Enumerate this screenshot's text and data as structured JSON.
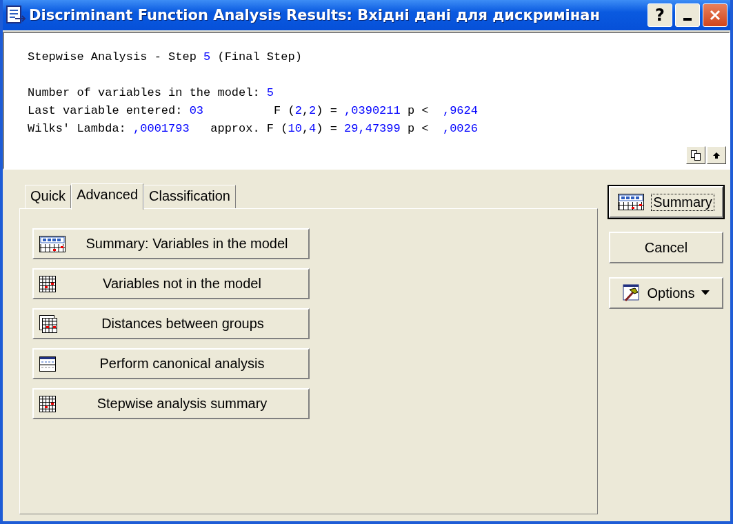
{
  "window": {
    "title": "Discriminant Function Analysis Results: Вхідні дані для дискримінан",
    "controls": [
      {
        "kind": "help",
        "label": "?"
      },
      {
        "kind": "minimize"
      },
      {
        "kind": "close"
      }
    ]
  },
  "output": {
    "paragraphs": [
      [
        [
          {
            "kind": "label",
            "text": "Stepwise Analysis - Step "
          },
          {
            "kind": "value",
            "text": "5"
          },
          {
            "kind": "label",
            "text": " (Final Step)"
          }
        ]
      ],
      [
        [
          {
            "kind": "label",
            "text": "Number of variables in the model: "
          },
          {
            "kind": "value",
            "text": "5"
          }
        ],
        [
          {
            "kind": "label",
            "text": "Last variable entered: "
          },
          {
            "kind": "value",
            "text": "03"
          },
          {
            "kind": "label",
            "text": "          F ("
          },
          {
            "kind": "value",
            "text": "2"
          },
          {
            "kind": "label",
            "text": ","
          },
          {
            "kind": "value",
            "text": "2"
          },
          {
            "kind": "label",
            "text": ") = "
          },
          {
            "kind": "value",
            "text": ",0390211"
          },
          {
            "kind": "label",
            "text": " p <  "
          },
          {
            "kind": "value",
            "text": ",9624"
          }
        ],
        [
          {
            "kind": "label",
            "text": "Wilks' Lambda: "
          },
          {
            "kind": "value",
            "text": ",0001793"
          },
          {
            "kind": "label",
            "text": "   approx. F ("
          },
          {
            "kind": "value",
            "text": "10"
          },
          {
            "kind": "label",
            "text": ","
          },
          {
            "kind": "value",
            "text": "4"
          },
          {
            "kind": "label",
            "text": ") = "
          },
          {
            "kind": "value",
            "text": "29,47399"
          },
          {
            "kind": "label",
            "text": " p <  "
          },
          {
            "kind": "value",
            "text": ",0026"
          }
        ]
      ]
    ],
    "tools": [
      {
        "kind": "copy"
      },
      {
        "kind": "collapse"
      }
    ]
  },
  "tabs": [
    {
      "label": "Quick",
      "selected": false
    },
    {
      "label": "Advanced",
      "selected": true
    },
    {
      "label": "Classification",
      "selected": false
    }
  ],
  "actions": [
    {
      "label": "Summary:  Variables in the model",
      "kind": "summary"
    },
    {
      "label": "Variables not in the model",
      "kind": "grid"
    },
    {
      "label": "Distances between groups",
      "kind": "stack"
    },
    {
      "label": "Perform canonical analysis",
      "kind": "form"
    },
    {
      "label": "Stepwise analysis summary",
      "kind": "grid"
    }
  ],
  "side_buttons": [
    {
      "label": "Summary",
      "kind": "summary",
      "default": true
    },
    {
      "label": "Cancel",
      "kind": "plain",
      "default": false
    },
    {
      "label": "Options",
      "kind": "options",
      "default": false
    }
  ]
}
